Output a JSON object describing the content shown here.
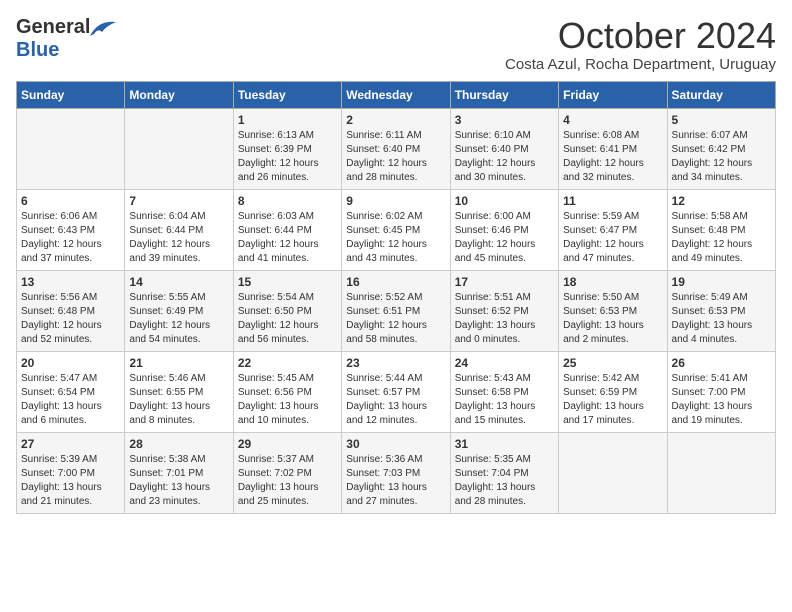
{
  "header": {
    "logo_general": "General",
    "logo_blue": "Blue",
    "month_title": "October 2024",
    "location": "Costa Azul, Rocha Department, Uruguay"
  },
  "days_of_week": [
    "Sunday",
    "Monday",
    "Tuesday",
    "Wednesday",
    "Thursday",
    "Friday",
    "Saturday"
  ],
  "weeks": [
    [
      {
        "day": "",
        "info": ""
      },
      {
        "day": "",
        "info": ""
      },
      {
        "day": "1",
        "info": "Sunrise: 6:13 AM\nSunset: 6:39 PM\nDaylight: 12 hours and 26 minutes."
      },
      {
        "day": "2",
        "info": "Sunrise: 6:11 AM\nSunset: 6:40 PM\nDaylight: 12 hours and 28 minutes."
      },
      {
        "day": "3",
        "info": "Sunrise: 6:10 AM\nSunset: 6:40 PM\nDaylight: 12 hours and 30 minutes."
      },
      {
        "day": "4",
        "info": "Sunrise: 6:08 AM\nSunset: 6:41 PM\nDaylight: 12 hours and 32 minutes."
      },
      {
        "day": "5",
        "info": "Sunrise: 6:07 AM\nSunset: 6:42 PM\nDaylight: 12 hours and 34 minutes."
      }
    ],
    [
      {
        "day": "6",
        "info": "Sunrise: 6:06 AM\nSunset: 6:43 PM\nDaylight: 12 hours and 37 minutes."
      },
      {
        "day": "7",
        "info": "Sunrise: 6:04 AM\nSunset: 6:44 PM\nDaylight: 12 hours and 39 minutes."
      },
      {
        "day": "8",
        "info": "Sunrise: 6:03 AM\nSunset: 6:44 PM\nDaylight: 12 hours and 41 minutes."
      },
      {
        "day": "9",
        "info": "Sunrise: 6:02 AM\nSunset: 6:45 PM\nDaylight: 12 hours and 43 minutes."
      },
      {
        "day": "10",
        "info": "Sunrise: 6:00 AM\nSunset: 6:46 PM\nDaylight: 12 hours and 45 minutes."
      },
      {
        "day": "11",
        "info": "Sunrise: 5:59 AM\nSunset: 6:47 PM\nDaylight: 12 hours and 47 minutes."
      },
      {
        "day": "12",
        "info": "Sunrise: 5:58 AM\nSunset: 6:48 PM\nDaylight: 12 hours and 49 minutes."
      }
    ],
    [
      {
        "day": "13",
        "info": "Sunrise: 5:56 AM\nSunset: 6:48 PM\nDaylight: 12 hours and 52 minutes."
      },
      {
        "day": "14",
        "info": "Sunrise: 5:55 AM\nSunset: 6:49 PM\nDaylight: 12 hours and 54 minutes."
      },
      {
        "day": "15",
        "info": "Sunrise: 5:54 AM\nSunset: 6:50 PM\nDaylight: 12 hours and 56 minutes."
      },
      {
        "day": "16",
        "info": "Sunrise: 5:52 AM\nSunset: 6:51 PM\nDaylight: 12 hours and 58 minutes."
      },
      {
        "day": "17",
        "info": "Sunrise: 5:51 AM\nSunset: 6:52 PM\nDaylight: 13 hours and 0 minutes."
      },
      {
        "day": "18",
        "info": "Sunrise: 5:50 AM\nSunset: 6:53 PM\nDaylight: 13 hours and 2 minutes."
      },
      {
        "day": "19",
        "info": "Sunrise: 5:49 AM\nSunset: 6:53 PM\nDaylight: 13 hours and 4 minutes."
      }
    ],
    [
      {
        "day": "20",
        "info": "Sunrise: 5:47 AM\nSunset: 6:54 PM\nDaylight: 13 hours and 6 minutes."
      },
      {
        "day": "21",
        "info": "Sunrise: 5:46 AM\nSunset: 6:55 PM\nDaylight: 13 hours and 8 minutes."
      },
      {
        "day": "22",
        "info": "Sunrise: 5:45 AM\nSunset: 6:56 PM\nDaylight: 13 hours and 10 minutes."
      },
      {
        "day": "23",
        "info": "Sunrise: 5:44 AM\nSunset: 6:57 PM\nDaylight: 13 hours and 12 minutes."
      },
      {
        "day": "24",
        "info": "Sunrise: 5:43 AM\nSunset: 6:58 PM\nDaylight: 13 hours and 15 minutes."
      },
      {
        "day": "25",
        "info": "Sunrise: 5:42 AM\nSunset: 6:59 PM\nDaylight: 13 hours and 17 minutes."
      },
      {
        "day": "26",
        "info": "Sunrise: 5:41 AM\nSunset: 7:00 PM\nDaylight: 13 hours and 19 minutes."
      }
    ],
    [
      {
        "day": "27",
        "info": "Sunrise: 5:39 AM\nSunset: 7:00 PM\nDaylight: 13 hours and 21 minutes."
      },
      {
        "day": "28",
        "info": "Sunrise: 5:38 AM\nSunset: 7:01 PM\nDaylight: 13 hours and 23 minutes."
      },
      {
        "day": "29",
        "info": "Sunrise: 5:37 AM\nSunset: 7:02 PM\nDaylight: 13 hours and 25 minutes."
      },
      {
        "day": "30",
        "info": "Sunrise: 5:36 AM\nSunset: 7:03 PM\nDaylight: 13 hours and 27 minutes."
      },
      {
        "day": "31",
        "info": "Sunrise: 5:35 AM\nSunset: 7:04 PM\nDaylight: 13 hours and 28 minutes."
      },
      {
        "day": "",
        "info": ""
      },
      {
        "day": "",
        "info": ""
      }
    ]
  ]
}
